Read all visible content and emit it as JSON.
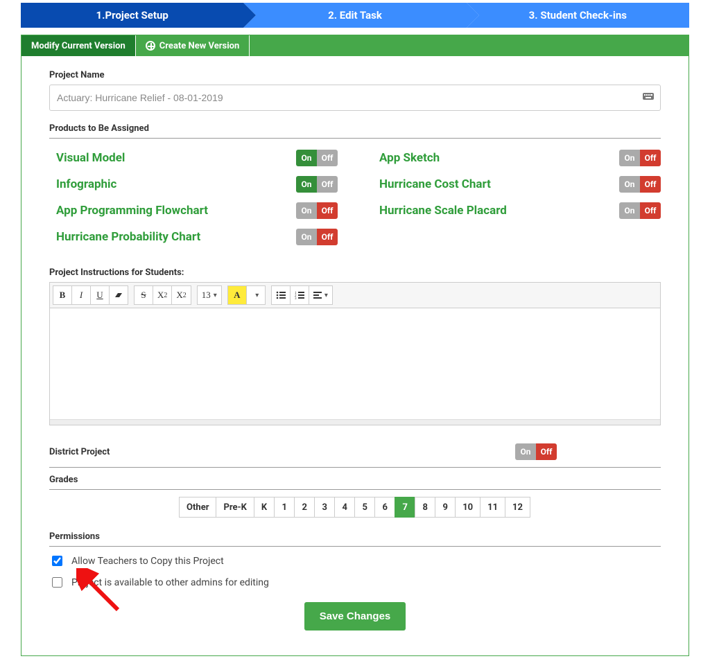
{
  "stepper": {
    "step1": "1.Project Setup",
    "step2": "2. Edit Task",
    "step3": "3. Student Check-ins"
  },
  "version_tabs": {
    "modify": "Modify Current Version",
    "create_new": "Create New Version"
  },
  "project_name": {
    "label": "Project Name",
    "value": "Actuary: Hurricane Relief - 08-01-2019"
  },
  "products_label": "Products to Be Assigned",
  "toggle_labels": {
    "on": "On",
    "off": "Off"
  },
  "products_left": [
    {
      "name": "Visual Model",
      "state": "on"
    },
    {
      "name": "Infographic",
      "state": "on"
    },
    {
      "name": "App Programming Flowchart",
      "state": "off"
    },
    {
      "name": "Hurricane Probability Chart",
      "state": "off"
    }
  ],
  "products_right": [
    {
      "name": "App Sketch",
      "state": "off"
    },
    {
      "name": "Hurricane Cost Chart",
      "state": "off"
    },
    {
      "name": "Hurricane Scale Placard",
      "state": "off"
    }
  ],
  "instructions_label": "Project Instructions for Students:",
  "toolbar": {
    "bold": "B",
    "italic": "I",
    "underline": "U",
    "eraser": "▬",
    "strike": "S",
    "sup": "X",
    "sup2": "2",
    "sub": "X",
    "sub2": "2",
    "size": "13",
    "color": "A",
    "ul": "≡",
    "ol": "≡",
    "align": "≡"
  },
  "district": {
    "label": "District Project",
    "state": "off"
  },
  "grades": {
    "label": "Grades",
    "items": [
      "Other",
      "Pre-K",
      "K",
      "1",
      "2",
      "3",
      "4",
      "5",
      "6",
      "7",
      "8",
      "9",
      "10",
      "11",
      "12"
    ],
    "active": "7"
  },
  "permissions": {
    "label": "Permissions",
    "allow_copy": {
      "text": "Allow Teachers to Copy this Project",
      "checked": true
    },
    "admin_edit": {
      "text": "Project is available to other admins for editing",
      "checked": false
    }
  },
  "save_button": "Save Changes"
}
